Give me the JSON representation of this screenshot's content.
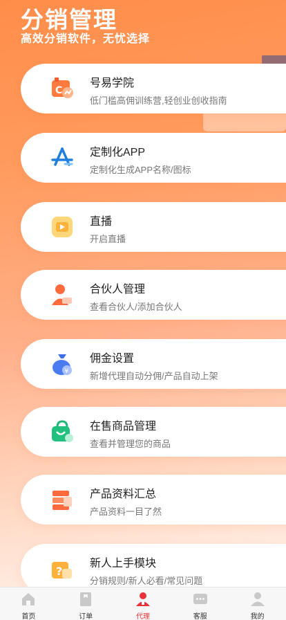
{
  "header": {
    "title": "分销管理",
    "subtitle": "高效分销软件，无忧选择"
  },
  "menu": [
    {
      "name": "号易学院",
      "desc": "低门槛高佣训练营,轻创业创收指南",
      "icon": "academy-icon"
    },
    {
      "name": "定制化APP",
      "desc": "定制化生成APP名称/图标",
      "icon": "app-store-icon"
    },
    {
      "name": "直播",
      "desc": "开启直播",
      "icon": "live-video-icon"
    },
    {
      "name": "合伙人管理",
      "desc": "查看合伙人/添加合伙人",
      "icon": "partner-icon"
    },
    {
      "name": "佣金设置",
      "desc": "新增代理自动分佣/产品自动上架",
      "icon": "money-bag-icon"
    },
    {
      "name": "在售商品管理",
      "desc": "查看并管理您的商品",
      "icon": "shopping-bag-icon"
    },
    {
      "name": "产品资料汇总",
      "desc": "产品资料一目了然",
      "icon": "document-stack-icon"
    },
    {
      "name": "新人上手模块",
      "desc": "分销规则/新人必看/常见问题",
      "icon": "question-folder-icon"
    }
  ],
  "tabbar": {
    "active": "代理",
    "items": [
      {
        "label": "首页",
        "icon": "home-icon"
      },
      {
        "label": "订单",
        "icon": "order-icon"
      },
      {
        "label": "代理",
        "icon": "agent-icon"
      },
      {
        "label": "客服",
        "icon": "chat-icon"
      },
      {
        "label": "我的",
        "icon": "user-icon"
      }
    ]
  },
  "colors": {
    "accent": "#ff8d4a",
    "active_tab": "#e8333a"
  }
}
